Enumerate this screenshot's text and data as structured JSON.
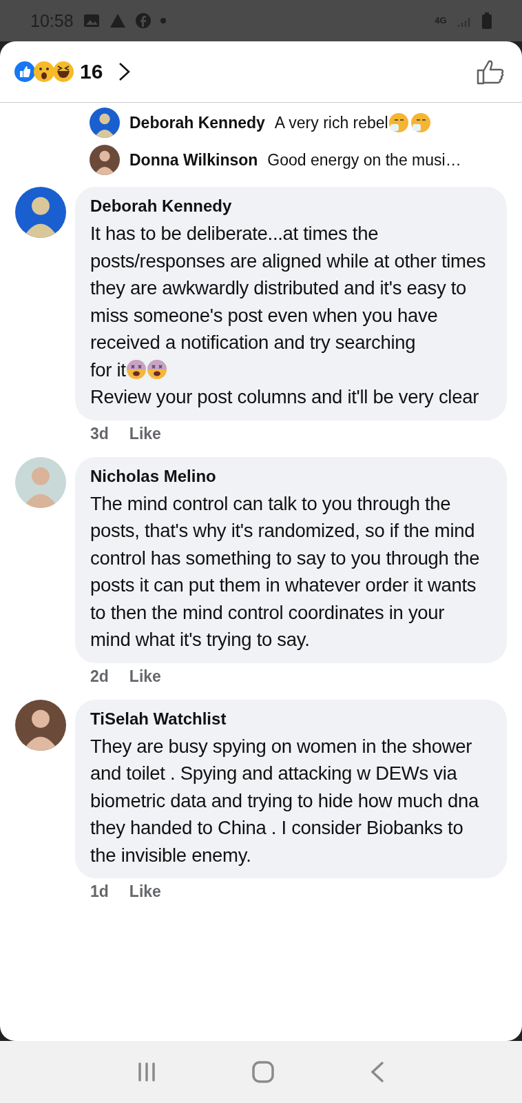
{
  "status_bar": {
    "time": "10:58",
    "network": "4G"
  },
  "header": {
    "reaction_count": "16"
  },
  "replies": [
    {
      "name": "Deborah Kennedy",
      "text": "A very rich rebel",
      "emojis": [
        {
          "kind": "sneeze"
        },
        {
          "kind": "sneeze"
        }
      ]
    },
    {
      "name": "Donna Wilkinson",
      "text": "Good energy on the musi…"
    }
  ],
  "comments": [
    {
      "name": "Deborah Kennedy",
      "paragraphs": [
        {
          "text": "It has to be deliberate...at times the posts/responses are aligned while at other times they are awkwardly distributed and it's easy to miss someone's post even when you have received a notification and try searching"
        },
        {
          "text": "for it",
          "emojis": [
            {
              "kind": "dizzy"
            },
            {
              "kind": "dizzy"
            }
          ]
        },
        {
          "text": "Review your post columns and it'll be very clear"
        }
      ],
      "time": "3d",
      "action": "Like"
    },
    {
      "name": "Nicholas Melino",
      "paragraphs": [
        {
          "text": "The mind control can talk to you through the posts, that's why it's randomized, so if the mind control has something to say to you through the posts it can put them in whatever order it wants to then the mind control coordinates in your mind what it's trying to say."
        }
      ],
      "time": "2d",
      "action": "Like"
    },
    {
      "name": "TiSelah Watchlist",
      "paragraphs": [
        {
          "text": "They are busy spying on women in the shower and toilet . Spying and attacking w DEWs via biometric data and trying to hide how much dna they handed to China .  I consider Biobanks to the invisible enemy."
        }
      ],
      "time": "1d",
      "action": "Like"
    }
  ]
}
